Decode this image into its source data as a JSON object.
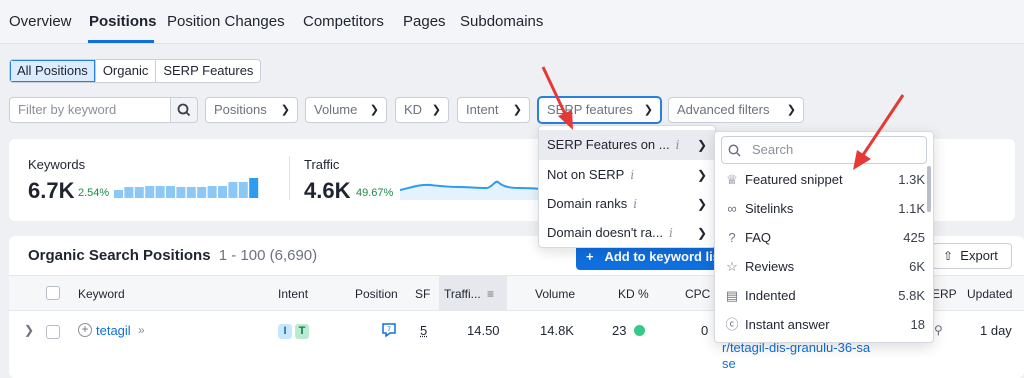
{
  "tabs": [
    "Overview",
    "Positions",
    "Position Changes",
    "Competitors",
    "Pages",
    "Subdomains"
  ],
  "segments": [
    "All Positions",
    "Organic",
    "SERP Features"
  ],
  "filters": {
    "keyword_placeholder": "Filter by keyword",
    "positions": "Positions",
    "volume": "Volume",
    "kd": "KD",
    "intent": "Intent",
    "serp_features": "SERP features",
    "advanced": "Advanced filters"
  },
  "metrics": {
    "keywords_label": "Keywords",
    "keywords_value": "6.7K",
    "keywords_pct": "2.54%",
    "traffic_label": "Traffic",
    "traffic_value": "4.6K",
    "traffic_pct": "49.67%",
    "keywords_bars": [
      40,
      55,
      55,
      60,
      60,
      60,
      55,
      55,
      55,
      60,
      60,
      80,
      80,
      100
    ]
  },
  "table": {
    "title": "Organic Search Positions",
    "range": "1 - 100 (6,690)",
    "add_button": "Add to keyword lis",
    "export": "Export",
    "headers": {
      "keyword": "Keyword",
      "intent": "Intent",
      "position": "Position",
      "sf": "SF",
      "traffic": "Traffi...",
      "volume": "Volume",
      "kd": "KD %",
      "cpc": "CPC",
      "serp": "ERP",
      "updated": "Updated"
    },
    "row": {
      "keyword": "tetagil",
      "intent1": "I",
      "intent2": "T",
      "sf": "5",
      "traffic": "14.50",
      "volume": "14.8K",
      "kd": "23",
      "cpc": "0",
      "url_line1": "r/tetagil-dis-granulu-36-sa",
      "url_line2": "se",
      "updated": "1 day"
    }
  },
  "menu1": [
    {
      "label": "SERP Features on ...",
      "info": "i"
    },
    {
      "label": "Not on SERP",
      "info": "i"
    },
    {
      "label": "Domain ranks",
      "info": "i"
    },
    {
      "label": "Domain doesn't ra...",
      "info": "i"
    }
  ],
  "menu2": {
    "search_placeholder": "Search",
    "items": [
      {
        "label": "Featured snippet",
        "count": "1.3K",
        "icon": "crown-icon"
      },
      {
        "label": "Sitelinks",
        "count": "1.1K",
        "icon": "link-icon"
      },
      {
        "label": "FAQ",
        "count": "425",
        "icon": "question-icon"
      },
      {
        "label": "Reviews",
        "count": "6K",
        "icon": "star-icon"
      },
      {
        "label": "Indented",
        "count": "5.8K",
        "icon": "indented-icon"
      },
      {
        "label": "Instant answer",
        "count": "18",
        "icon": "question-circle-icon"
      }
    ]
  },
  "colors": {
    "accent": "#0f6fde",
    "green": "#1b8a4a",
    "bar": "#8cc8f5",
    "annotation_arrow": "#e53935"
  }
}
